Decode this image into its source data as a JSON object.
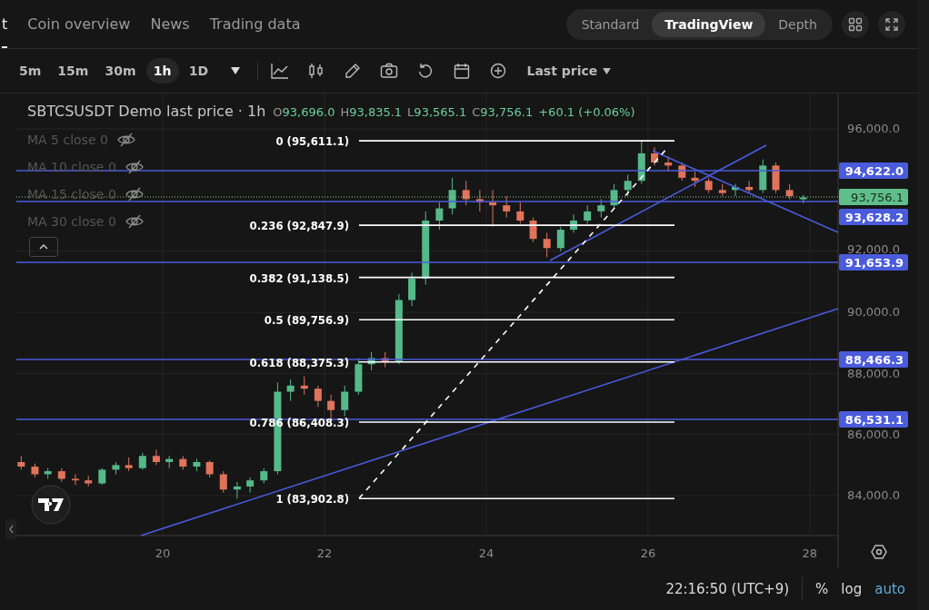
{
  "nav_tabs": [
    {
      "label": "t",
      "selected": true
    },
    {
      "label": "Coin overview",
      "selected": false
    },
    {
      "label": "News",
      "selected": false
    },
    {
      "label": "Trading data",
      "selected": false
    }
  ],
  "view_modes": [
    {
      "label": "Standard",
      "selected": false
    },
    {
      "label": "TradingView",
      "selected": true
    },
    {
      "label": "Depth",
      "selected": false
    }
  ],
  "toolbar": {
    "intervals": [
      {
        "label": "5m",
        "selected": false
      },
      {
        "label": "15m",
        "selected": false
      },
      {
        "label": "30m",
        "selected": false
      },
      {
        "label": "1h",
        "selected": true
      },
      {
        "label": "1D",
        "selected": false
      }
    ],
    "price_source": "Last price"
  },
  "chart": {
    "symbol": "SBTCSUSDT Demo last price · 1h",
    "ohlc": [
      {
        "letter": "O",
        "value": "93,696.0"
      },
      {
        "letter": "H",
        "value": "93,835.1"
      },
      {
        "letter": "L",
        "value": "93,565.1"
      },
      {
        "letter": "C",
        "value": "93,756.1"
      }
    ],
    "change": "+60.1 (+0.06%)",
    "indicators": [
      {
        "label": "MA 5 close 0",
        "visible": false
      },
      {
        "label": "MA 10 close 0",
        "visible": false
      },
      {
        "label": "MA 15 close 0",
        "visible": false
      },
      {
        "label": "MA 30 close 0",
        "visible": false
      }
    ],
    "price_tags": [
      {
        "kind": "line",
        "text": "94,622.0"
      },
      {
        "kind": "last",
        "text": "93,756.1"
      },
      {
        "kind": "line",
        "text": "93,628.2"
      },
      {
        "kind": "line",
        "text": "91,653.9"
      },
      {
        "kind": "line",
        "text": "88,466.3"
      },
      {
        "kind": "line",
        "text": "86,531.1"
      }
    ],
    "fib_levels": [
      "0 (95,611.1)",
      "0.236 (92,847.9)",
      "0.382 (91,138.5)",
      "0.5 (89,756.9)",
      "0.618 (88,375.3)",
      "0.786 (86,408.3)",
      "1 (83,902.8)"
    ],
    "chart_data": {
      "type": "candlestick",
      "x": [
        18.25,
        18.42,
        18.58,
        18.75,
        18.92,
        19.08,
        19.25,
        19.42,
        19.58,
        19.75,
        19.92,
        20.08,
        20.25,
        20.42,
        20.58,
        20.75,
        20.92,
        21.08,
        21.25,
        21.42,
        21.58,
        21.75,
        21.92,
        22.08,
        22.25,
        22.42,
        22.58,
        22.75,
        22.92,
        23.08,
        23.25,
        23.42,
        23.58,
        23.75,
        23.92,
        24.08,
        24.25,
        24.42,
        24.58,
        24.75,
        24.92,
        25.08,
        25.25,
        25.42,
        25.58,
        25.75,
        25.92,
        26.08,
        26.25,
        26.42,
        26.58,
        26.75,
        26.92,
        27.08,
        27.25,
        27.42,
        27.58,
        27.75,
        27.92
      ],
      "ohlc": [
        [
          85100,
          85300,
          84850,
          84950
        ],
        [
          84950,
          85050,
          84600,
          84700
        ],
        [
          84700,
          84900,
          84550,
          84800
        ],
        [
          84800,
          84900,
          84450,
          84550
        ],
        [
          84550,
          84700,
          84350,
          84500
        ],
        [
          84500,
          84650,
          84300,
          84400
        ],
        [
          84400,
          84900,
          84350,
          84850
        ],
        [
          84850,
          85100,
          84700,
          85000
        ],
        [
          85000,
          85250,
          84800,
          84900
        ],
        [
          84900,
          85400,
          84850,
          85300
        ],
        [
          85300,
          85500,
          85000,
          85100
        ],
        [
          85100,
          85300,
          84900,
          85200
        ],
        [
          85200,
          85300,
          84850,
          84950
        ],
        [
          84950,
          85200,
          84800,
          85100
        ],
        [
          85100,
          85150,
          84600,
          84700
        ],
        [
          84700,
          84800,
          84100,
          84200
        ],
        [
          84200,
          84450,
          83900,
          84300
        ],
        [
          84300,
          84600,
          84100,
          84500
        ],
        [
          84500,
          84900,
          84400,
          84800
        ],
        [
          84800,
          87700,
          84700,
          87400
        ],
        [
          87400,
          87800,
          87100,
          87600
        ],
        [
          87600,
          87900,
          87300,
          87500
        ],
        [
          87500,
          87600,
          86900,
          87100
        ],
        [
          87100,
          87300,
          86500,
          86800
        ],
        [
          86800,
          87600,
          86600,
          87400
        ],
        [
          87400,
          88500,
          87300,
          88300
        ],
        [
          88300,
          88700,
          88100,
          88500
        ],
        [
          88500,
          88700,
          88200,
          88400
        ],
        [
          88400,
          90600,
          88300,
          90400
        ],
        [
          90400,
          91300,
          90200,
          91100
        ],
        [
          91100,
          93300,
          90900,
          93000
        ],
        [
          93000,
          93600,
          92700,
          93400
        ],
        [
          93400,
          94400,
          93200,
          94000
        ],
        [
          94000,
          94300,
          93500,
          93700
        ],
        [
          93700,
          94000,
          93300,
          93600
        ],
        [
          93600,
          94000,
          92800,
          93500
        ],
        [
          93500,
          93800,
          93100,
          93300
        ],
        [
          93300,
          93600,
          92900,
          93000
        ],
        [
          93000,
          93100,
          92300,
          92400
        ],
        [
          92400,
          92600,
          91800,
          92100
        ],
        [
          92100,
          92800,
          92000,
          92700
        ],
        [
          92700,
          93200,
          92600,
          93000
        ],
        [
          93000,
          93500,
          92900,
          93300
        ],
        [
          93300,
          93700,
          93100,
          93500
        ],
        [
          93500,
          94200,
          93400,
          94000
        ],
        [
          94000,
          94500,
          93800,
          94300
        ],
        [
          94300,
          95611,
          94200,
          95200
        ],
        [
          95200,
          95400,
          94800,
          94900
        ],
        [
          94900,
          95100,
          94600,
          94800
        ],
        [
          94800,
          94900,
          94300,
          94400
        ],
        [
          94400,
          94600,
          94100,
          94300
        ],
        [
          94300,
          94400,
          93900,
          94000
        ],
        [
          94000,
          94200,
          93800,
          93900
        ],
        [
          94000,
          94200,
          93800,
          94100
        ],
        [
          94100,
          94300,
          93900,
          94000
        ],
        [
          94000,
          95000,
          93900,
          94800
        ],
        [
          94800,
          94900,
          93900,
          94000
        ],
        [
          94000,
          94200,
          93700,
          93800
        ],
        [
          93696,
          93835,
          93565,
          93756
        ]
      ],
      "xlim": [
        18.19,
        28.35
      ],
      "ylim": [
        82694,
        97158
      ],
      "grid": true,
      "xticks": [
        {
          "value": 20,
          "label": "20"
        },
        {
          "value": 22,
          "label": "22"
        },
        {
          "value": 24,
          "label": "24"
        },
        {
          "value": 26,
          "label": "26"
        },
        {
          "value": 28,
          "label": "28"
        }
      ],
      "yticks": [
        {
          "value": 96000,
          "label": "96,000.0"
        },
        {
          "value": 92000,
          "label": "92,000.0"
        },
        {
          "value": 90000,
          "label": "90,000.0"
        },
        {
          "value": 88000,
          "label": "88,000.0"
        },
        {
          "value": 86000,
          "label": "86,000.0"
        },
        {
          "value": 84000,
          "label": "84,000.0"
        }
      ]
    }
  },
  "status_bar": {
    "time": "22:16:50 (UTC+9)",
    "scale_options": [
      {
        "label": "%",
        "selected": false
      },
      {
        "label": "log",
        "selected": false
      },
      {
        "label": "auto",
        "selected": true
      }
    ]
  }
}
